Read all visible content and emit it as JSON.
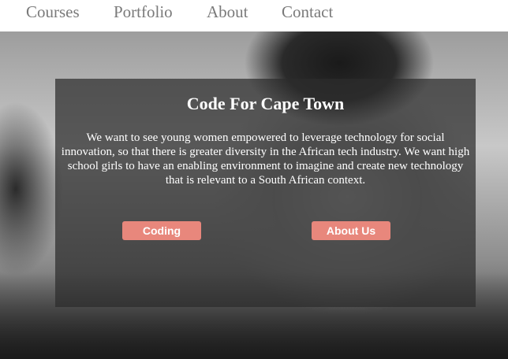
{
  "nav": {
    "items": [
      {
        "label": "Courses"
      },
      {
        "label": "Portfolio"
      },
      {
        "label": "About"
      },
      {
        "label": "Contact"
      }
    ]
  },
  "hero": {
    "title": "Code For Cape Town",
    "description": "We want to see young women empowered to leverage technology for social innovation, so that there is greater diversity in the African tech industry. We want high school girls to have an enabling environment to imagine and create new technology that is relevant to a South African context.",
    "buttons": {
      "coding": "Coding",
      "about_us": "About Us"
    }
  },
  "colors": {
    "button_bg": "#e8877c",
    "nav_text": "#7a7a7a",
    "card_bg": "rgba(45,45,45,0.72)"
  }
}
